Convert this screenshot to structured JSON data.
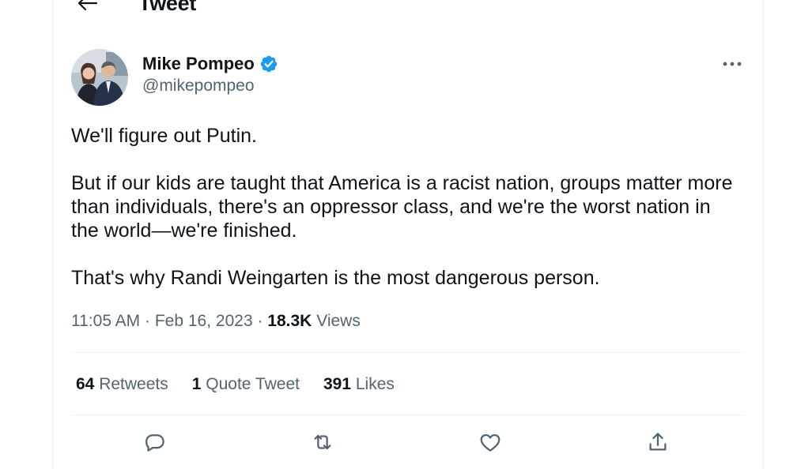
{
  "header": {
    "title": "Tweet",
    "back_icon": "arrow-left-icon"
  },
  "author": {
    "display_name": "Mike Pompeo",
    "handle": "@mikepompeo",
    "verified_icon": "verified-badge-icon",
    "verified_color": "#1d9bf0"
  },
  "tweet": {
    "paragraphs": [
      "We'll figure out Putin.",
      "But if our kids are taught that America is a racist nation, groups matter more than individuals, there's an oppressor class, and we're the worst nation in the world—we're finished.",
      "That's why Randi Weingarten is the most dangerous person."
    ]
  },
  "meta": {
    "time": "11:05 AM",
    "separator": "·",
    "date": "Feb 16, 2023",
    "views_count": "18.3K",
    "views_label": "Views"
  },
  "stats": {
    "retweets_count": "64",
    "retweets_label": "Retweets",
    "quotes_count": "1",
    "quotes_label": "Quote Tweet",
    "likes_count": "391",
    "likes_label": "Likes"
  },
  "actions": {
    "reply_icon": "reply-icon",
    "retweet_icon": "retweet-icon",
    "like_icon": "heart-icon",
    "share_icon": "share-icon",
    "more_icon": "more-horizontal-icon"
  },
  "colors": {
    "text": "#0f1419",
    "secondary": "#536471",
    "divider": "#eff3f4",
    "icon": "#536471"
  }
}
